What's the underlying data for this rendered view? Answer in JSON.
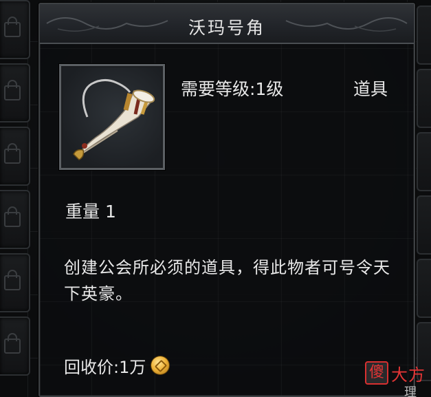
{
  "tooltip": {
    "title": "沃玛号角",
    "level_requirement": "需要等级:1级",
    "item_type": "道具",
    "weight": "重量 1",
    "description": "创建公会所必须的道具，得此物者可号令天下英豪。",
    "recycle_price": "回收价:1万",
    "icon": "horn-icon",
    "currency_icon": "gold-coin-icon"
  },
  "watermark": {
    "badge": "傻",
    "text": "大方"
  },
  "corner_fragment": "理",
  "colors": {
    "text": "#e8e8e8",
    "panel_bg": "#0c0d0f",
    "border": "#3d4043",
    "coin_gold": "#f0b43a",
    "watermark_red": "#e23535"
  }
}
